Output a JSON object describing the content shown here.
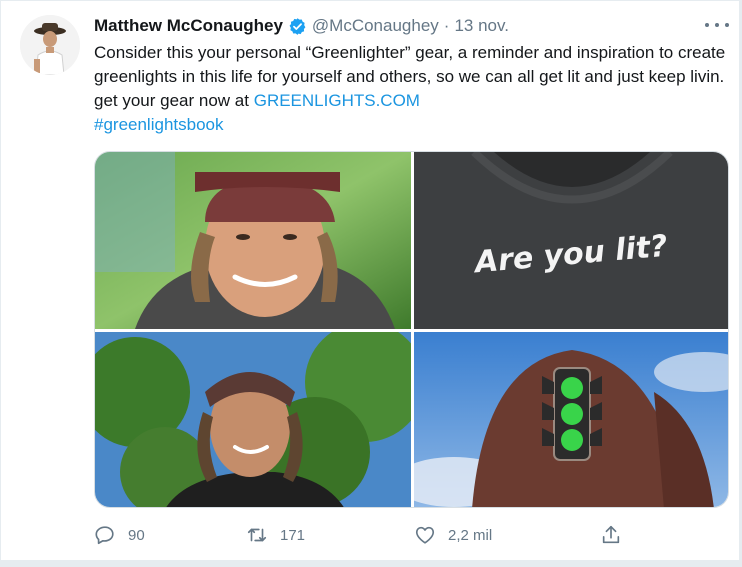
{
  "tweet": {
    "author_name": "Matthew McConaughey",
    "handle": "@McConaughey",
    "separator": "·",
    "date": "13 nov.",
    "text_main": "Consider this your personal “Greenlighter” gear, a reminder and inspiration to create greenlights in this life for yourself and others, so we can all get lit and just keep livin. get your gear now at ",
    "link_text": "GREENLIGHTS.COM",
    "hashtag": "#greenlightsbook",
    "media": {
      "shirt_text": "Are you lit?"
    },
    "stats": {
      "replies": "90",
      "retweets": "171",
      "likes": "2,2 mil"
    }
  },
  "colors": {
    "accent": "#1b95e0",
    "verified": "#1da1f2",
    "muted": "#657786",
    "text": "#14171a",
    "traffic_light_green": "#39d44a"
  },
  "icons": {
    "verified": "verified-badge-icon",
    "more": "more-options-icon",
    "reply": "reply-icon",
    "retweet": "retweet-icon",
    "like": "heart-icon",
    "share": "share-icon"
  }
}
